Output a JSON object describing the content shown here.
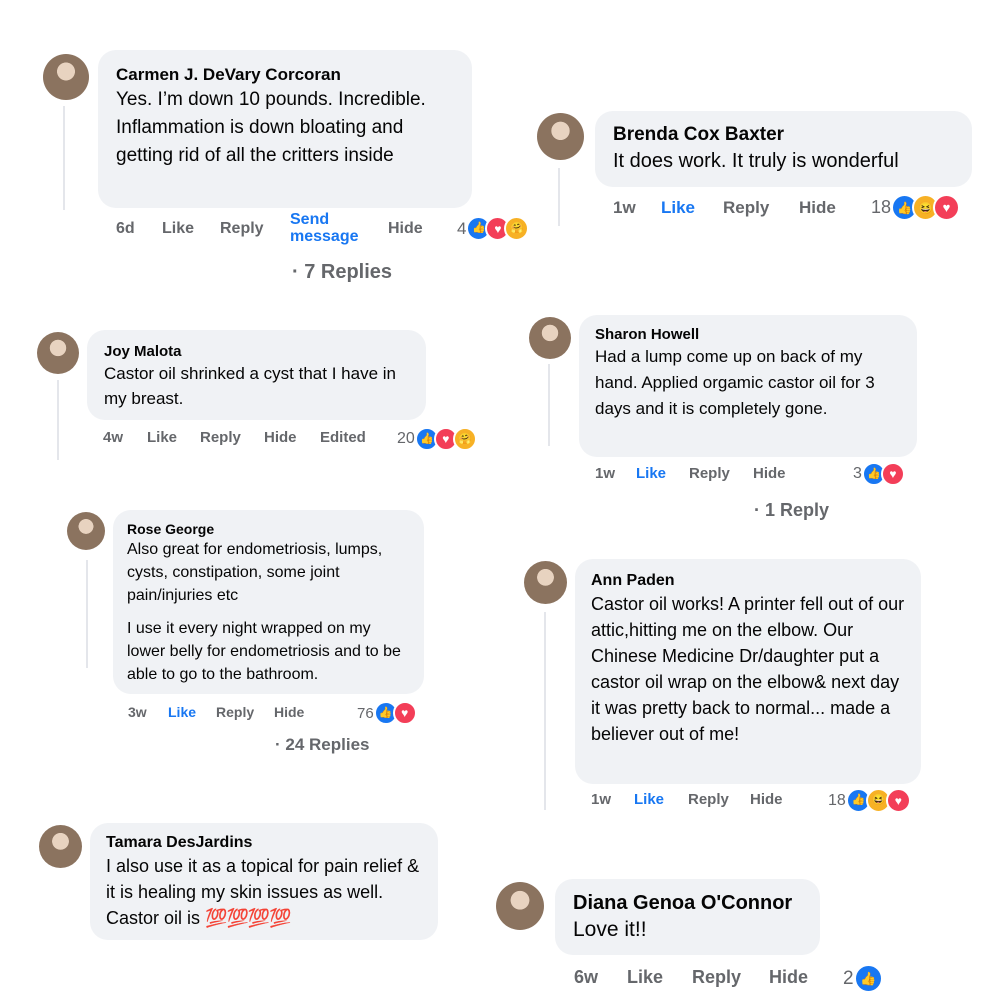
{
  "comments": [
    {
      "name": "Carmen J. DeVary Corcoran",
      "text": "Yes. I’m down 10 pounds. Incredible. Inflammation is down bloating and getting rid of all the critters inside",
      "meta": [
        "6d",
        "Like",
        "Reply",
        "Send message",
        "Hide"
      ],
      "reaction_count": "4",
      "reactions": [
        "like",
        "love",
        "care"
      ],
      "replies": "· 7 Replies"
    },
    {
      "name": "Brenda Cox Baxter",
      "text": "It does work. It truly is wonderful",
      "meta": [
        "1w",
        "Like",
        "Reply",
        "Hide"
      ],
      "liked": true,
      "reaction_count": "18",
      "reactions": [
        "like",
        "haha",
        "love"
      ]
    },
    {
      "name": "Joy Malota",
      "text": "Castor oil shrinked a cyst that I have in my breast.",
      "meta": [
        "4w",
        "Like",
        "Reply",
        "Hide",
        "Edited"
      ],
      "reaction_count": "20",
      "reactions": [
        "like",
        "love",
        "care"
      ]
    },
    {
      "name": "Sharon Howell",
      "text": "Had a lump come up on back of my hand. Applied orgamic castor oil for 3 days and it is completely gone.",
      "meta": [
        "1w",
        "Like",
        "Reply",
        "Hide"
      ],
      "liked": true,
      "reaction_count": "3",
      "reactions": [
        "like",
        "love"
      ],
      "replies": "· 1 Reply"
    },
    {
      "name": "Rose George",
      "text": "Also great for endometriosis, lumps, cysts, constipation, some joint pain/injuries etc",
      "text2": "I use it every night wrapped on my lower belly for endometriosis and to be able to go to the bathroom.",
      "meta": [
        "3w",
        "Like",
        "Reply",
        "Hide"
      ],
      "liked": true,
      "reaction_count": "76",
      "reactions": [
        "like",
        "love"
      ],
      "replies": "· 24 Replies"
    },
    {
      "name": "Ann Paden",
      "text": "Castor oil works! A printer fell out of our attic,hitting me on the elbow. Our Chinese Medicine Dr/daughter put a castor oil wrap on the elbow& next day it was pretty back to normal... made a believer out of me!",
      "meta": [
        "1w",
        "Like",
        "Reply",
        "Hide"
      ],
      "liked": true,
      "reaction_count": "18",
      "reactions": [
        "like",
        "haha",
        "love"
      ]
    },
    {
      "name": "Tamara DesJardins",
      "text": "I also use it as a topical for pain relief & it is healing my skin issues as well. Castor oil is",
      "emoji": "💯💯💯💯"
    },
    {
      "name": "Diana Genoa O'Connor",
      "text": "Love it!!",
      "meta": [
        "6w",
        "Like",
        "Reply",
        "Hide"
      ],
      "reaction_count": "2",
      "reactions": [
        "like"
      ]
    }
  ],
  "icons": {
    "like": "👍",
    "love": "♥",
    "haha": "😆",
    "care": "🤗"
  },
  "colors": {
    "bubble": "#f0f2f5",
    "meta_text": "#65676b",
    "like_blue": "#1877f2",
    "love_red": "#f33e58",
    "haha_yellow": "#f7b125"
  }
}
